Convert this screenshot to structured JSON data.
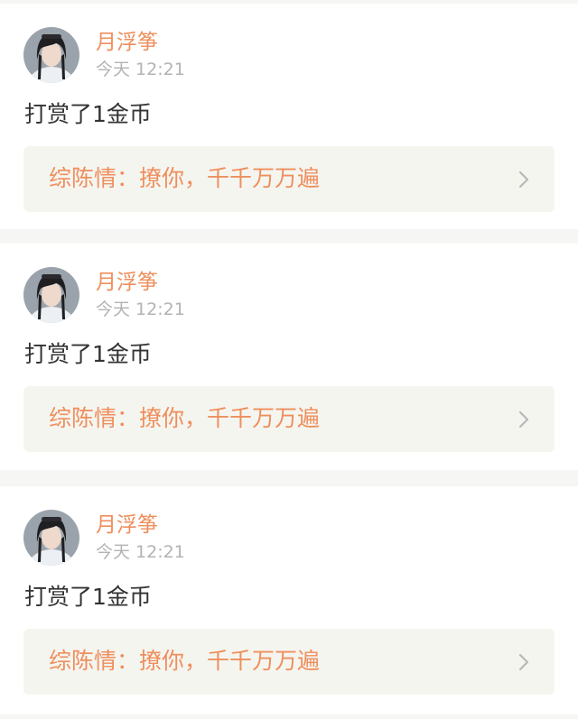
{
  "colors": {
    "accent": "#ee8f5d",
    "timestamp": "#b3b3b3",
    "text": "#333333",
    "link_background": "#f5f5f0",
    "page_background": "#f6f6f4"
  },
  "items": [
    {
      "user": "月浮筝",
      "time": "今天 12:21",
      "message": "打赏了1金币",
      "link": "综陈情：撩你，千千万万遍",
      "avatar_icon": "user-avatar",
      "link_icon": "chevron-right-icon"
    },
    {
      "user": "月浮筝",
      "time": "今天 12:21",
      "message": "打赏了1金币",
      "link": "综陈情：撩你，千千万万遍",
      "avatar_icon": "user-avatar",
      "link_icon": "chevron-right-icon"
    },
    {
      "user": "月浮筝",
      "time": "今天 12:21",
      "message": "打赏了1金币",
      "link": "综陈情：撩你，千千万万遍",
      "avatar_icon": "user-avatar",
      "link_icon": "chevron-right-icon"
    }
  ]
}
